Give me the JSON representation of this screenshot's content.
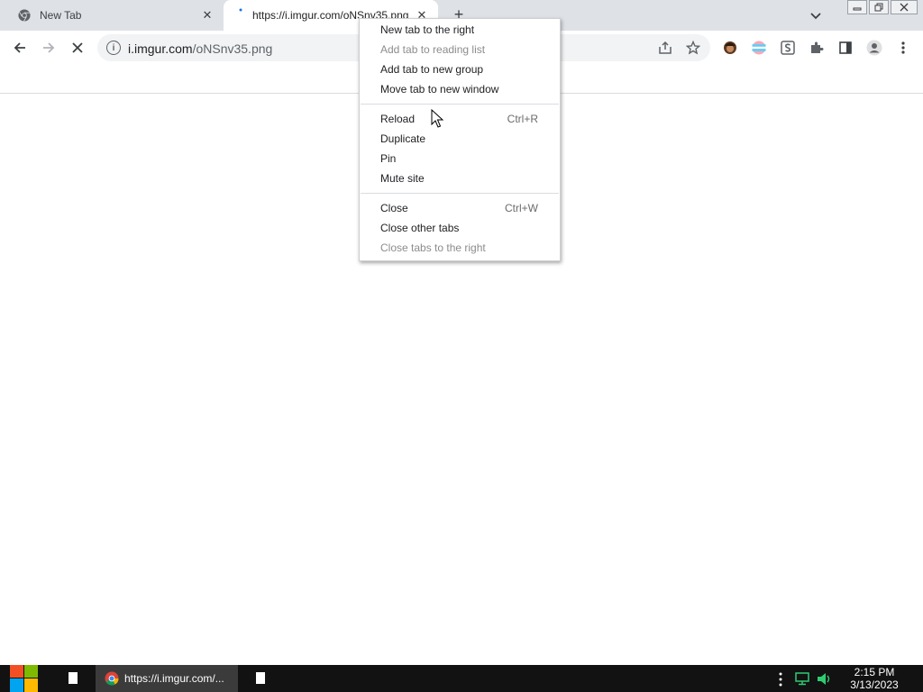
{
  "tabs": [
    {
      "title": "New Tab",
      "icon": "chrome-icon"
    },
    {
      "title": "https://i.imgur.com/oNSnv35.png",
      "icon": "loading-icon"
    }
  ],
  "new_tab_label": "+",
  "toolbar": {
    "url_host": "i.imgur.com",
    "url_path": "/oNSnv35.png",
    "omni_info": "i"
  },
  "context_menu": {
    "items": [
      {
        "label": "New tab to the right",
        "shortcut": "",
        "disabled": false
      },
      {
        "label": "Add tab to reading list",
        "shortcut": "",
        "disabled": true
      },
      {
        "label": "Add tab to new group",
        "shortcut": "",
        "disabled": false
      },
      {
        "label": "Move tab to new window",
        "shortcut": "",
        "disabled": false
      },
      {
        "label": "Reload",
        "shortcut": "Ctrl+R",
        "disabled": false
      },
      {
        "label": "Duplicate",
        "shortcut": "",
        "disabled": false
      },
      {
        "label": "Pin",
        "shortcut": "",
        "disabled": false
      },
      {
        "label": "Mute site",
        "shortcut": "",
        "disabled": false
      },
      {
        "label": "Close",
        "shortcut": "Ctrl+W",
        "disabled": false
      },
      {
        "label": "Close other tabs",
        "shortcut": "",
        "disabled": false
      },
      {
        "label": "Close tabs to the right",
        "shortcut": "",
        "disabled": true
      }
    ]
  },
  "taskbar": {
    "chrome_button_label": "https://i.imgur.com/...",
    "time": "2:15 PM",
    "date": "3/13/2023"
  },
  "colors": {
    "tabstrip": "#dee1e6",
    "taskbar": "#121212",
    "start_red": "#f25022",
    "start_green": "#7fba00",
    "start_blue": "#00a4ef",
    "start_yellow": "#ffb900"
  }
}
